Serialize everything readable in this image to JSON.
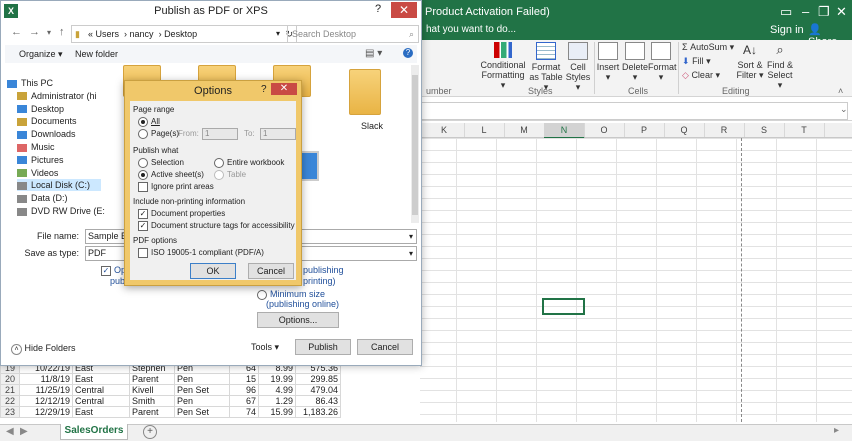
{
  "excel": {
    "title": "Product Activation Failed)",
    "tell_me": "hat you want to do...",
    "sign_in": "Sign in",
    "share": "Share",
    "ribbon": {
      "cond_formatting": "Conditional Formatting",
      "format_as_table": "Format as Table",
      "cell_styles": "Cell Styles",
      "insert": "Insert",
      "delete": "Delete",
      "format": "Format",
      "autosum": "AutoSum",
      "fill": "Fill",
      "clear": "Clear",
      "sort_filter": "Sort & Filter",
      "find_select": "Find & Select",
      "groups": [
        "umber",
        "Styles",
        "Cells",
        "Editing"
      ]
    },
    "columns": [
      "K",
      "L",
      "M",
      "N",
      "O",
      "P",
      "Q",
      "R",
      "S",
      "T"
    ],
    "selected_column": "N",
    "rows": [
      {
        "n": "19",
        "date": "10/22/19",
        "region": "East",
        "rep": "Stephen",
        "item": "Pen",
        "units": "64",
        "cost": "8.99",
        "total": "575.36"
      },
      {
        "n": "20",
        "date": "11/8/19",
        "region": "East",
        "rep": "Parent",
        "item": "Pen",
        "units": "15",
        "cost": "19.99",
        "total": "299.85"
      },
      {
        "n": "21",
        "date": "11/25/19",
        "region": "Central",
        "rep": "Kivell",
        "item": "Pen Set",
        "units": "96",
        "cost": "4.99",
        "total": "479.04"
      },
      {
        "n": "22",
        "date": "12/12/19",
        "region": "Central",
        "rep": "Smith",
        "item": "Pen",
        "units": "67",
        "cost": "1.29",
        "total": "86.43"
      },
      {
        "n": "23",
        "date": "12/29/19",
        "region": "East",
        "rep": "Parent",
        "item": "Pen Set",
        "units": "74",
        "cost": "15.99",
        "total": "1,183.26"
      }
    ],
    "sheet_tab": "SalesOrders"
  },
  "publish": {
    "title": "Publish as PDF or XPS",
    "help": "?",
    "path": [
      "Users",
      "nancy",
      "Desktop"
    ],
    "search_placeholder": "Search Desktop",
    "organize": "Organize",
    "new_folder": "New folder",
    "nav": [
      "This PC",
      "Administrator (hi",
      "Desktop",
      "Documents",
      "Downloads",
      "Music",
      "Pictures",
      "Videos",
      "Local Disk (C:)",
      "Data (D:)",
      "DVD RW Drive (E:"
    ],
    "folder_label": "Slack",
    "file_name_label": "File name:",
    "file_name_value": "Sample Exc",
    "save_type_label": "Save as type:",
    "save_type_value": "PDF",
    "open_after_1": "Ope",
    "open_after_2": "pub",
    "optimize_std_1": "publishing",
    "optimize_std_2": "printing)",
    "min_size_1": "Minimum size",
    "min_size_2": "(publishing online)",
    "options_btn": "Options...",
    "hide_folders": "Hide Folders",
    "tools": "Tools",
    "publish_btn": "Publish",
    "cancel_btn": "Cancel"
  },
  "options": {
    "title": "Options",
    "help": "?",
    "page_range": "Page range",
    "all": "All",
    "pages": "Page(s)",
    "from": "From:",
    "from_val": "1",
    "to": "To:",
    "to_val": "1",
    "publish_what": "Publish what",
    "selection": "Selection",
    "entire_workbook": "Entire workbook",
    "active_sheets": "Active sheet(s)",
    "table": "Table",
    "ignore_print_areas": "Ignore print areas",
    "non_printing": "Include non-printing information",
    "doc_properties": "Document properties",
    "doc_structure": "Document structure tags for accessibility",
    "pdf_options": "PDF options",
    "iso": "ISO 19005-1 compliant (PDF/A)",
    "ok": "OK",
    "cancel": "Cancel"
  }
}
